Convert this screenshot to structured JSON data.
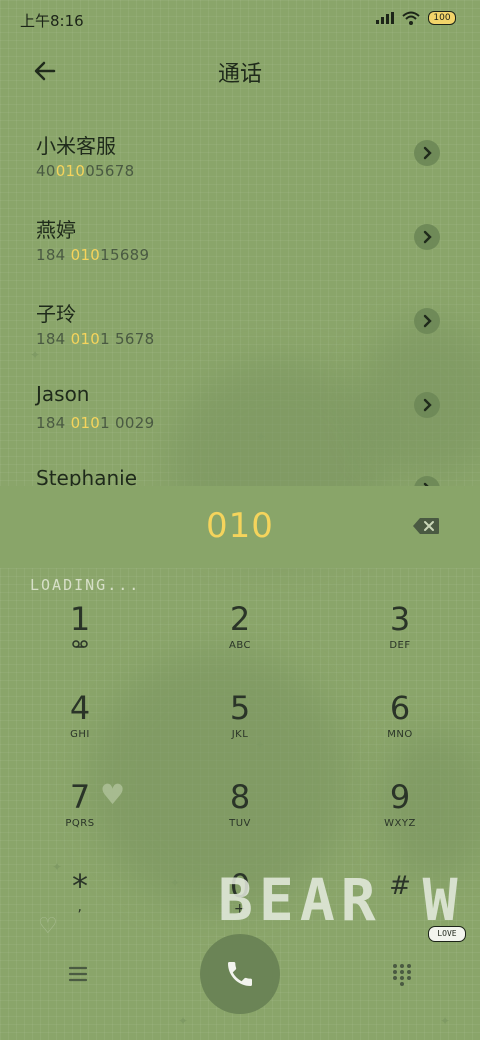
{
  "status_bar": {
    "time": "上午8:16",
    "battery": "100"
  },
  "header": {
    "title": "通话"
  },
  "contacts": [
    {
      "name": "小米客服",
      "number_pre": "40",
      "number_hl": "010",
      "number_post": "05678"
    },
    {
      "name": "燕婷",
      "number_pre": "184 ",
      "number_hl": "010",
      "number_post": "15689"
    },
    {
      "name": "子玲",
      "number_pre": "184 ",
      "number_hl": "010",
      "number_post": "1 5678"
    },
    {
      "name": "Jason",
      "number_pre": "184 ",
      "number_hl": "010",
      "number_post": "1 0029"
    },
    {
      "name": "Stephanie",
      "number_pre": "",
      "number_hl": "",
      "number_post": ""
    }
  ],
  "dial": {
    "number": "010"
  },
  "overlay": {
    "loading": "LOADING...",
    "bear": "BEAR W",
    "love": "LOVE"
  },
  "keypad": [
    {
      "digit": "1",
      "letters": ""
    },
    {
      "digit": "2",
      "letters": "ABC"
    },
    {
      "digit": "3",
      "letters": "DEF"
    },
    {
      "digit": "4",
      "letters": "GHI"
    },
    {
      "digit": "5",
      "letters": "JKL"
    },
    {
      "digit": "6",
      "letters": "MNO"
    },
    {
      "digit": "7",
      "letters": "PQRS"
    },
    {
      "digit": "8",
      "letters": "TUV"
    },
    {
      "digit": "9",
      "letters": "WXYZ"
    },
    {
      "digit": "*",
      "letters": ","
    },
    {
      "digit": "0",
      "letters": "+"
    },
    {
      "digit": "#",
      "letters": ""
    }
  ],
  "colors": {
    "background": "#8aa56a",
    "highlight": "#f5d45c"
  }
}
